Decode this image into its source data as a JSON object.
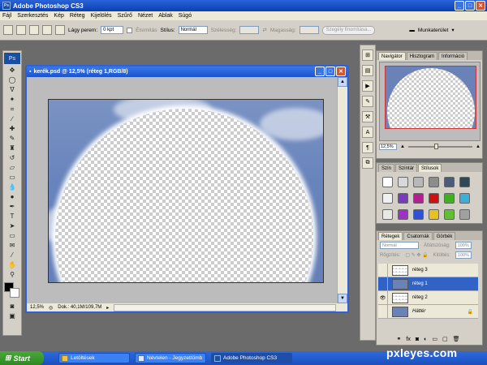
{
  "app": {
    "title": "Adobe Photoshop CS3"
  },
  "menu": [
    "Fájl",
    "Szerkesztés",
    "Kép",
    "Réteg",
    "Kijelölés",
    "Szűrő",
    "Nézet",
    "Ablak",
    "Súgó"
  ],
  "options": {
    "feather_label": "Lágy perem:",
    "feather_value": "0 kpt",
    "antialias_label": "Élsimítás",
    "style_label": "Stílus:",
    "style_value": "Normál",
    "width_label": "Szélesség:",
    "height_label": "Magasság:",
    "refine_button": "Szegély finomítása...",
    "workspace_label": "Munkaterület"
  },
  "document": {
    "title": "kerék.psd @ 12,5% (réteg 1,RGB/8)",
    "zoom": "12,5%",
    "doc_info": "Dok.: 40,1M/109,7M"
  },
  "navigator": {
    "tabs": [
      "Navigátor",
      "Hisztogram",
      "Információ"
    ],
    "zoom": "12,5%"
  },
  "swatches": {
    "tabs": [
      "Szín",
      "Színtár",
      "Stílusok"
    ],
    "colors": [
      "#ffffff",
      "#d8d8d8",
      "#b8b8b8",
      "#8c8c8c",
      "#4a5b7c",
      "#2a4a5a",
      "#f0f0f0",
      "#7a3ac0",
      "#b02090",
      "#d01010",
      "#40b020",
      "#3ab0d8",
      "#e8e8e8",
      "#a030c8",
      "#3050d8",
      "#e8c020",
      "#60c030",
      "#a0a0a0"
    ]
  },
  "layers": {
    "tabs": [
      "Rétegek",
      "Csatornák",
      "Görbék"
    ],
    "blend": "Normál",
    "opacity_label": "Átlátszóság:",
    "opacity": "100%",
    "lock_label": "Rögzítés:",
    "fill_label": "Kitöltés:",
    "fill": "100%",
    "items": [
      {
        "name": "réteg 3"
      },
      {
        "name": "réteg 1"
      },
      {
        "name": "réteg 2"
      },
      {
        "name": "Háttér"
      }
    ]
  },
  "taskbar": {
    "start": "Start",
    "tasks": [
      "Letöltések",
      "Névtelen - Jegyzettömb",
      "Adobe Photoshop CS3"
    ]
  },
  "watermark": "pxleyes.com"
}
